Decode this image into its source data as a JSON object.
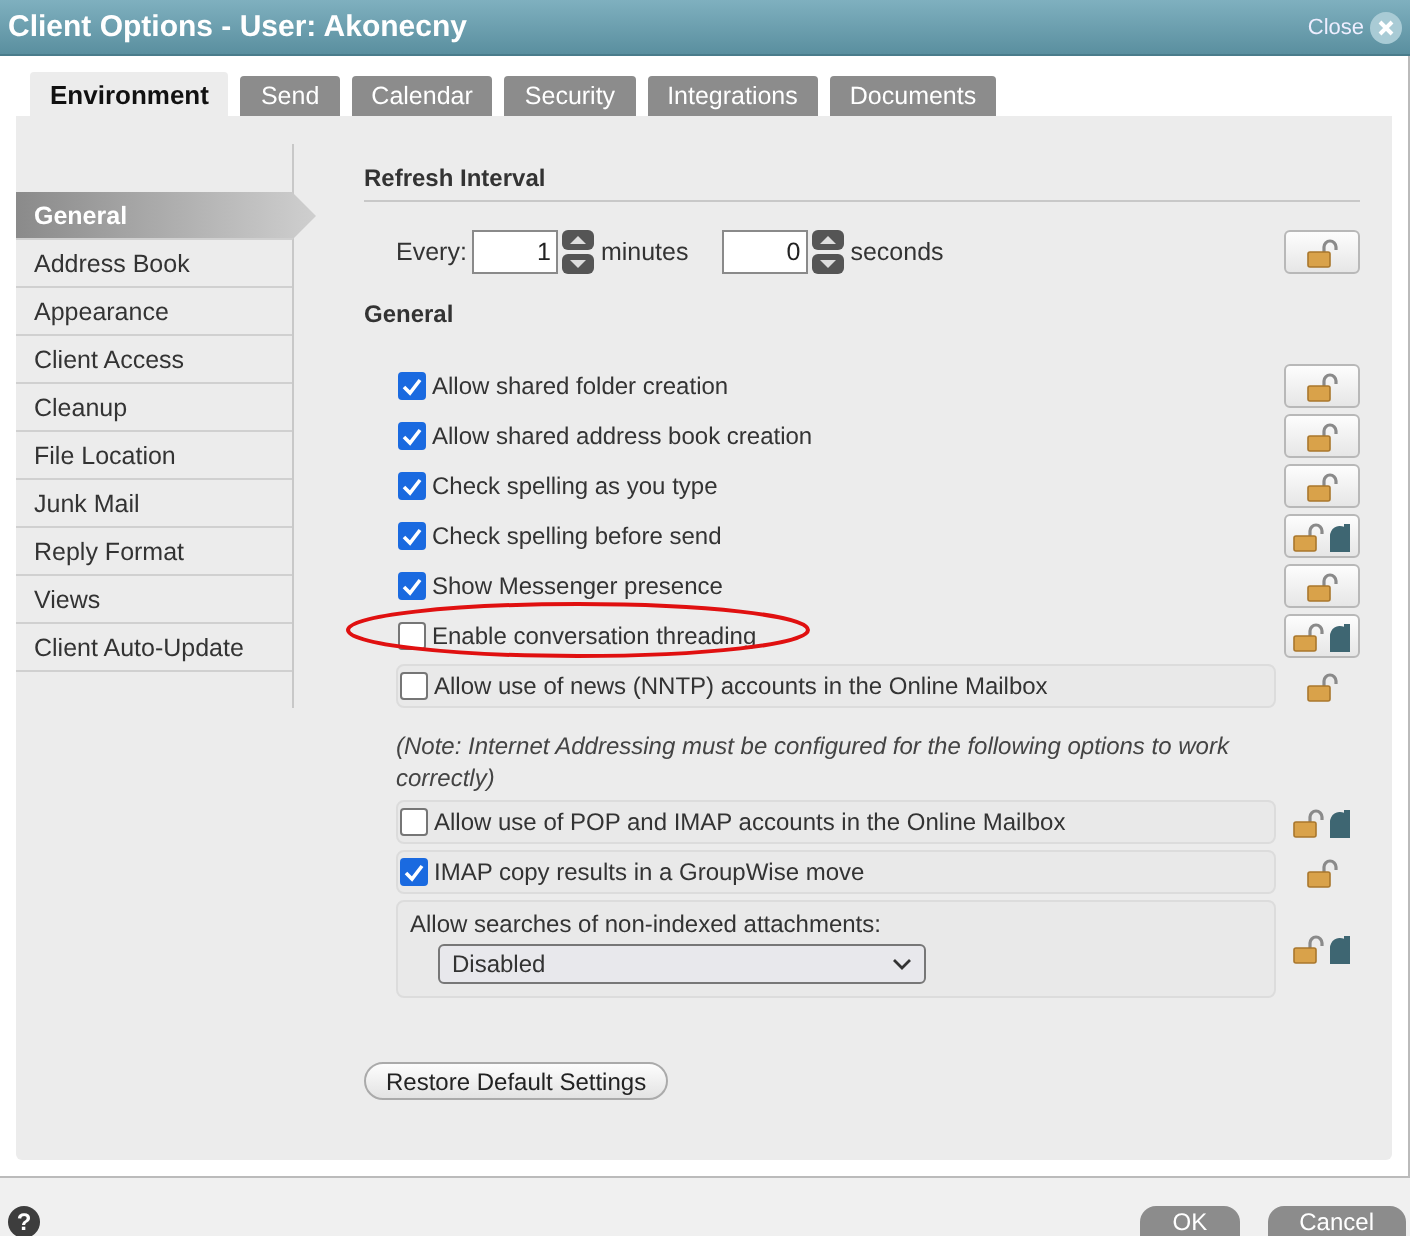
{
  "window": {
    "title": "Client Options - User: Akonecny",
    "close_label": "Close"
  },
  "tabs": [
    {
      "label": "Environment",
      "selected": true
    },
    {
      "label": "Send",
      "selected": false
    },
    {
      "label": "Calendar",
      "selected": false
    },
    {
      "label": "Security",
      "selected": false
    },
    {
      "label": "Integrations",
      "selected": false
    },
    {
      "label": "Documents",
      "selected": false
    }
  ],
  "sidebar": {
    "items": [
      {
        "label": "General",
        "selected": true
      },
      {
        "label": "Address Book",
        "selected": false
      },
      {
        "label": "Appearance",
        "selected": false
      },
      {
        "label": "Client Access",
        "selected": false
      },
      {
        "label": "Cleanup",
        "selected": false
      },
      {
        "label": "File Location",
        "selected": false
      },
      {
        "label": "Junk Mail",
        "selected": false
      },
      {
        "label": "Reply Format",
        "selected": false
      },
      {
        "label": "Views",
        "selected": false
      },
      {
        "label": "Client Auto-Update",
        "selected": false
      }
    ]
  },
  "refresh_interval": {
    "heading": "Refresh Interval",
    "every_label": "Every:",
    "minutes_value": "1",
    "minutes_label": "minutes",
    "seconds_value": "0",
    "seconds_label": "seconds",
    "lock": {
      "button": true,
      "locked": false
    }
  },
  "general": {
    "heading": "General",
    "options": [
      {
        "kind": "checkbox",
        "label": "Allow shared folder creation",
        "checked": true,
        "framed": false,
        "highlighted": false,
        "lock": {
          "button": true,
          "locked": false
        }
      },
      {
        "kind": "checkbox",
        "label": "Allow shared address book creation",
        "checked": true,
        "framed": false,
        "highlighted": false,
        "lock": {
          "button": true,
          "locked": false
        }
      },
      {
        "kind": "checkbox",
        "label": "Check spelling as you type",
        "checked": true,
        "framed": false,
        "highlighted": false,
        "lock": {
          "button": true,
          "locked": false
        }
      },
      {
        "kind": "checkbox",
        "label": "Check spelling before send",
        "checked": true,
        "framed": false,
        "highlighted": false,
        "lock": {
          "button": true,
          "locked": true
        }
      },
      {
        "kind": "checkbox",
        "label": "Show Messenger presence",
        "checked": true,
        "framed": false,
        "highlighted": false,
        "lock": {
          "button": true,
          "locked": false
        }
      },
      {
        "kind": "checkbox",
        "label": "Enable conversation threading",
        "checked": false,
        "framed": false,
        "highlighted": true,
        "lock": {
          "button": true,
          "locked": true
        }
      },
      {
        "kind": "checkbox",
        "label": "Allow use of news (NNTP) accounts in the Online Mailbox",
        "checked": false,
        "framed": true,
        "highlighted": false,
        "lock": {
          "button": false,
          "locked": false
        }
      },
      {
        "kind": "note",
        "label": "(Note: Internet Addressing must be configured for the following options to work correctly)"
      },
      {
        "kind": "checkbox",
        "label": "Allow use of POP and IMAP accounts in the Online Mailbox",
        "checked": false,
        "framed": true,
        "highlighted": false,
        "lock": {
          "button": false,
          "locked": true
        }
      },
      {
        "kind": "checkbox",
        "label": "IMAP copy results in a GroupWise move",
        "checked": true,
        "framed": true,
        "highlighted": false,
        "lock": {
          "button": false,
          "locked": false
        }
      },
      {
        "kind": "select",
        "label": "Allow searches of non-indexed attachments:",
        "value": "Disabled",
        "framed": true,
        "highlighted": false,
        "lock": {
          "button": false,
          "locked": true
        }
      }
    ]
  },
  "restore_button": "Restore Default Settings",
  "footer": {
    "help": "?",
    "buttons": [
      "OK",
      "Cancel"
    ]
  }
}
